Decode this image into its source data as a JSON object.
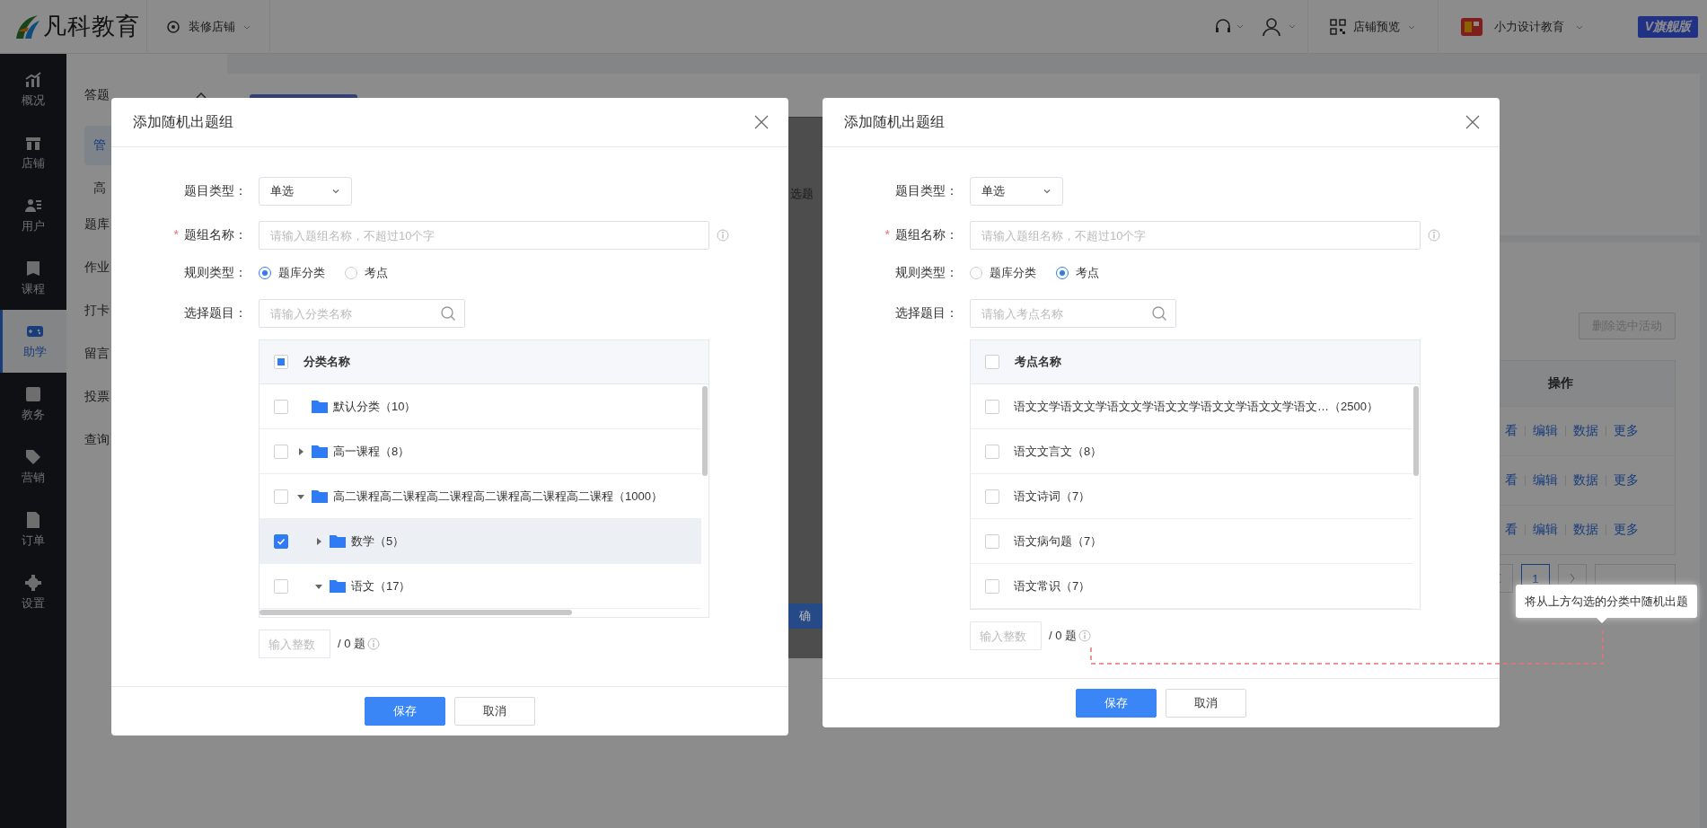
{
  "topbar": {
    "logo_text": "凡科教育",
    "shop_decor": "装修店铺",
    "shop_preview": "店铺预览",
    "account": "小力设计教育",
    "edition": "V旗舰版"
  },
  "sidebar": {
    "items": [
      {
        "label": "概况",
        "selected": false
      },
      {
        "label": "店铺",
        "selected": false
      },
      {
        "label": "用户",
        "selected": false
      },
      {
        "label": "课程",
        "selected": false
      },
      {
        "label": "助学",
        "selected": true
      },
      {
        "label": "教务",
        "selected": false
      },
      {
        "label": "营销",
        "selected": false
      },
      {
        "label": "订单",
        "selected": false
      },
      {
        "label": "设置",
        "selected": false
      }
    ]
  },
  "subnav": {
    "items": [
      {
        "label": "答题",
        "expanded": true,
        "children": [
          {
            "label": "管",
            "selected": true
          },
          {
            "label": "高",
            "selected": false
          }
        ]
      },
      {
        "label": "题库"
      },
      {
        "label": "作业"
      },
      {
        "label": "打卡"
      },
      {
        "label": "留言"
      },
      {
        "label": "投票"
      },
      {
        "label": "查询"
      }
    ]
  },
  "background_dialog": {
    "text": "选题",
    "button": "确"
  },
  "activities": {
    "delete_button": "删除选中活动",
    "delete_disabled": true,
    "column": "操作",
    "rows": [
      {
        "actions": [
          "看",
          "编辑",
          "数据",
          "更多"
        ]
      },
      {
        "actions": [
          "看",
          "编辑",
          "数据",
          "更多"
        ]
      },
      {
        "actions": [
          "看",
          "编辑",
          "数据",
          "更多"
        ]
      }
    ],
    "pages": [
      {
        "label": "1",
        "selected": true
      }
    ]
  },
  "dialogs": [
    {
      "title": "添加随机出题组",
      "type_label": "题目类型：",
      "type_value": "单选",
      "name_label": "题组名称：",
      "required_mark": "*",
      "name_placeholder": "请输入题组名称，不超过10个字",
      "rule_label": "规则类型：",
      "rule_options": [
        {
          "label": "题库分类",
          "selected": true
        },
        {
          "label": "考点",
          "selected": false
        }
      ],
      "pick_label": "选择题目：",
      "search_placeholder": "请输入分类名称",
      "table": {
        "kind": "tree",
        "header": "分类名称",
        "header_checked": false,
        "header_indeterminate": true,
        "rows": [
          {
            "label": "默认分类（10）",
            "checked": false,
            "selected": false
          },
          {
            "label": "高一课程（8）",
            "checked": false,
            "selected": false,
            "expanded": false
          },
          {
            "label": "高二课程高二课程高二课程高二课程高二课程高二课程（1000）",
            "checked": false,
            "selected": false,
            "expanded": true,
            "children": [
              {
                "label": "数学（5）",
                "checked": true,
                "selected": true,
                "expanded": false
              },
              {
                "label": "语文（17）",
                "checked": false,
                "selected": false,
                "expanded": true
              }
            ]
          }
        ]
      },
      "count_placeholder": "输入整数",
      "count_suffix": "/ 0 题",
      "save": "保存",
      "cancel": "取消"
    },
    {
      "title": "添加随机出题组",
      "type_label": "题目类型：",
      "type_value": "单选",
      "name_label": "题组名称：",
      "required_mark": "*",
      "name_placeholder": "请输入题组名称，不超过10个字",
      "rule_label": "规则类型：",
      "rule_options": [
        {
          "label": "题库分类",
          "selected": false
        },
        {
          "label": "考点",
          "selected": true
        }
      ],
      "pick_label": "选择题目：",
      "search_placeholder": "请输入考点名称",
      "table": {
        "kind": "list",
        "header": "考点名称",
        "header_checked": false,
        "header_indeterminate": false,
        "rows": [
          {
            "label": "语文文学语文文学语文文学语文文学语文文学语文文学语文…（2500）",
            "checked": false,
            "selected": false
          },
          {
            "label": "语文文言文（8）",
            "checked": false,
            "selected": false
          },
          {
            "label": "语文诗词（7）",
            "checked": false,
            "selected": false
          },
          {
            "label": "语文病句题（7）",
            "checked": false,
            "selected": false
          },
          {
            "label": "语文常识（7）",
            "checked": false,
            "selected": false
          }
        ]
      },
      "count_placeholder": "输入整数",
      "count_suffix": "/ 0 题",
      "save": "保存",
      "cancel": "取消"
    }
  ],
  "tooltip": {
    "text": "将从上方勾选的分类中随机出题"
  }
}
